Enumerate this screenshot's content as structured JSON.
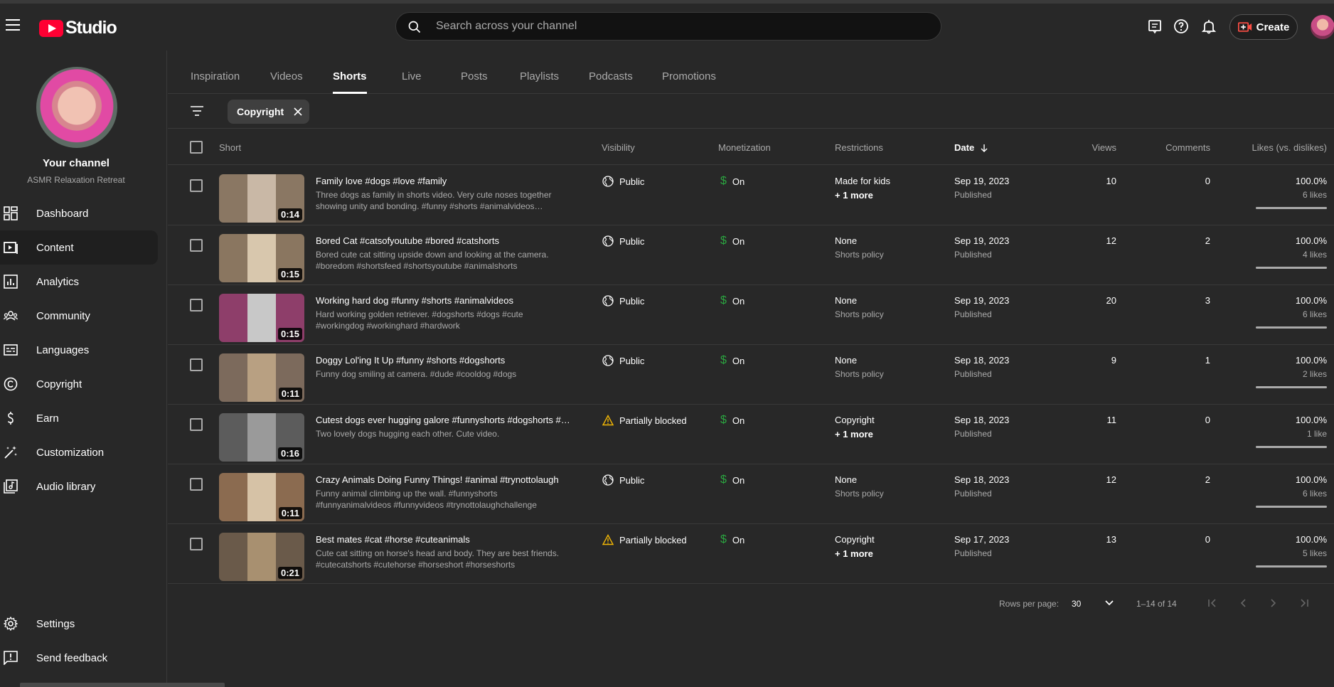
{
  "app": {
    "logo_text": "Studio"
  },
  "search": {
    "placeholder": "Search across your channel"
  },
  "header": {
    "create_label": "Create"
  },
  "channel": {
    "title": "Your channel",
    "name": "ASMR Relaxation Retreat"
  },
  "sidebar": {
    "items": [
      {
        "label": "Dashboard",
        "icon": "dashboard-icon"
      },
      {
        "label": "Content",
        "icon": "content-icon",
        "active": true
      },
      {
        "label": "Analytics",
        "icon": "analytics-icon"
      },
      {
        "label": "Community",
        "icon": "community-icon"
      },
      {
        "label": "Languages",
        "icon": "languages-icon"
      },
      {
        "label": "Copyright",
        "icon": "copyright-icon"
      },
      {
        "label": "Earn",
        "icon": "earn-icon"
      },
      {
        "label": "Customization",
        "icon": "customization-icon"
      },
      {
        "label": "Audio library",
        "icon": "audio-library-icon"
      }
    ],
    "bottom": [
      {
        "label": "Settings",
        "icon": "settings-icon"
      },
      {
        "label": "Send feedback",
        "icon": "feedback-icon"
      }
    ]
  },
  "tabs": [
    {
      "label": "Inspiration"
    },
    {
      "label": "Videos"
    },
    {
      "label": "Shorts",
      "active": true
    },
    {
      "label": "Live"
    },
    {
      "label": "Posts"
    },
    {
      "label": "Playlists"
    },
    {
      "label": "Podcasts"
    },
    {
      "label": "Promotions"
    }
  ],
  "filter": {
    "chip_label": "Copyright"
  },
  "table": {
    "headers": {
      "short": "Short",
      "visibility": "Visibility",
      "monetization": "Monetization",
      "restrictions": "Restrictions",
      "date": "Date",
      "views": "Views",
      "comments": "Comments",
      "likes": "Likes (vs. dislikes)"
    },
    "rows": [
      {
        "title": "Family love #dogs #love #family",
        "description": "Three dogs as family in shorts video. Very cute noses together showing unity and bonding. #funny #shorts #animalvideos…",
        "duration": "0:14",
        "visibility": "Public",
        "vis_icon": "globe-icon",
        "monetization": "On",
        "restriction": "Made for kids",
        "restriction_sub": "+ 1 more",
        "restriction_sub_bold": true,
        "date": "Sep 19, 2023",
        "status": "Published",
        "views": "10",
        "comments": "0",
        "likes_pct": "100.0%",
        "likes_count": "6 likes",
        "likes_ratio": 1.0,
        "thumb_bg": "#8a7763",
        "thumb_center": "#c9b8a6"
      },
      {
        "title": "Bored Cat #catsofyoutube #bored #catshorts",
        "description": "Bored cute cat sitting upside down and looking at the camera. #boredom #shortsfeed #shortsyoutube #animalshorts",
        "duration": "0:15",
        "visibility": "Public",
        "vis_icon": "globe-icon",
        "monetization": "On",
        "restriction": "None",
        "restriction_sub": "Shorts policy",
        "restriction_sub_bold": false,
        "date": "Sep 19, 2023",
        "status": "Published",
        "views": "12",
        "comments": "2",
        "likes_pct": "100.0%",
        "likes_count": "4 likes",
        "likes_ratio": 1.0,
        "thumb_bg": "#8a7660",
        "thumb_center": "#d8c7ad"
      },
      {
        "title": "Working hard dog #funny #shorts #animalvideos",
        "description": "Hard working golden retriever. #dogshorts #dogs #cute #workingdog #workinghard #hardwork",
        "duration": "0:15",
        "visibility": "Public",
        "vis_icon": "globe-icon",
        "monetization": "On",
        "restriction": "None",
        "restriction_sub": "Shorts policy",
        "restriction_sub_bold": false,
        "date": "Sep 19, 2023",
        "status": "Published",
        "views": "20",
        "comments": "3",
        "likes_pct": "100.0%",
        "likes_count": "6 likes",
        "likes_ratio": 1.0,
        "thumb_bg": "#8e3e6a",
        "thumb_center": "#c8c8c8"
      },
      {
        "title": "Doggy Lol'ing It Up #funny #shorts #dogshorts",
        "description": "Funny dog smiling at camera. #dude #cooldog #dogs",
        "duration": "0:11",
        "visibility": "Public",
        "vis_icon": "globe-icon",
        "monetization": "On",
        "restriction": "None",
        "restriction_sub": "Shorts policy",
        "restriction_sub_bold": false,
        "date": "Sep 18, 2023",
        "status": "Published",
        "views": "9",
        "comments": "1",
        "likes_pct": "100.0%",
        "likes_count": "2 likes",
        "likes_ratio": 1.0,
        "thumb_bg": "#7c6a5c",
        "thumb_center": "#b8a082"
      },
      {
        "title": "Cutest dogs ever hugging galore #funnyshorts #dogshorts #…",
        "description": "Two lovely dogs hugging each other. Cute video.",
        "duration": "0:16",
        "visibility": "Partially blocked",
        "vis_icon": "warning-icon",
        "monetization": "On",
        "restriction": "Copyright",
        "restriction_sub": "+ 1 more",
        "restriction_sub_bold": true,
        "date": "Sep 18, 2023",
        "status": "Published",
        "views": "11",
        "comments": "0",
        "likes_pct": "100.0%",
        "likes_count": "1 like",
        "likes_ratio": 1.0,
        "thumb_bg": "#5c5c5c",
        "thumb_center": "#9a9a9a"
      },
      {
        "title": "Crazy Animals Doing Funny Things! #animal #trynottolaugh",
        "description": "Funny animal climbing up the wall. #funnyshorts #funnyanimalvideos #funnyvideos #trynottolaughchallenge",
        "duration": "0:11",
        "visibility": "Public",
        "vis_icon": "globe-icon",
        "monetization": "On",
        "restriction": "None",
        "restriction_sub": "Shorts policy",
        "restriction_sub_bold": false,
        "date": "Sep 18, 2023",
        "status": "Published",
        "views": "12",
        "comments": "2",
        "likes_pct": "100.0%",
        "likes_count": "6 likes",
        "likes_ratio": 1.0,
        "thumb_bg": "#8b6b50",
        "thumb_center": "#d6c2a6"
      },
      {
        "title": "Best mates #cat #horse #cuteanimals",
        "description": "Cute cat sitting on horse's head and body. They are best friends. #cutecatshorts #cutehorse #horseshort #horseshorts",
        "duration": "0:21",
        "visibility": "Partially blocked",
        "vis_icon": "warning-icon",
        "monetization": "On",
        "restriction": "Copyright",
        "restriction_sub": "+ 1 more",
        "restriction_sub_bold": true,
        "date": "Sep 17, 2023",
        "status": "Published",
        "views": "13",
        "comments": "0",
        "likes_pct": "100.0%",
        "likes_count": "5 likes",
        "likes_ratio": 1.0,
        "thumb_bg": "#6a5a4a",
        "thumb_center": "#a89070"
      }
    ]
  },
  "pagination": {
    "rows_per_page_label": "Rows per page:",
    "rows_per_page": "30",
    "range": "1–14 of 14"
  },
  "colors": {
    "accent_red": "#ff0033",
    "monetization_green": "#2ba640",
    "warning_yellow": "#f2b705"
  }
}
